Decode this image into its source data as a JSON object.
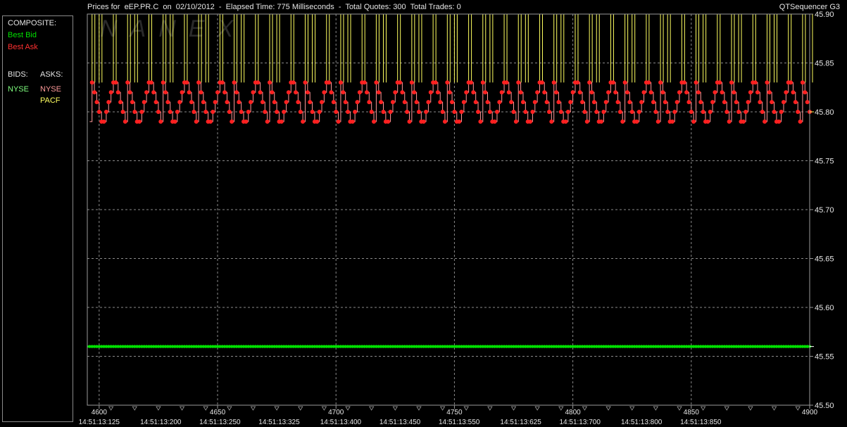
{
  "header": {
    "title": "Prices for  eEP.PR.C  on  02/10/2012  -  Elapsed Time: 775 Milliseconds  -  Total Quotes: 300  Total Trades: 0",
    "app_name": "QTSequencer G3"
  },
  "watermark": "NANEX",
  "legend": {
    "composite_label": "COMPOSITE:",
    "best_bid": "Best Bid",
    "best_ask": "Best Ask",
    "bids_label": "BIDS:",
    "asks_label": "ASKS:",
    "bid_exchanges": [
      "NYSE"
    ],
    "ask_exchanges": [
      "NYSE",
      "PACF"
    ],
    "colors": {
      "best_bid": "#00e000",
      "best_ask": "#ff2020",
      "nyse_bid": "#7fff7f",
      "nyse_ask": "#ff9a9a",
      "pacf_ask": "#ffff60"
    }
  },
  "chart_data": {
    "type": "line",
    "title": "Prices for  eEP.PR.C  on  02/10/2012",
    "xlabel": "",
    "ylabel": "",
    "ylim": [
      45.5,
      45.9
    ],
    "xlim": [
      4595,
      4900
    ],
    "grid": true,
    "yticks": [
      "45.50",
      "45.55",
      "45.60",
      "45.65",
      "45.70",
      "45.75",
      "45.80",
      "45.85",
      "45.90"
    ],
    "xticks": [
      {
        "x": 4600,
        "label": "4600"
      },
      {
        "x": 4650,
        "label": "4650"
      },
      {
        "x": 4700,
        "label": "4700"
      },
      {
        "x": 4750,
        "label": "4750"
      },
      {
        "x": 4800,
        "label": "4800"
      },
      {
        "x": 4850,
        "label": "4850"
      },
      {
        "x": 4900,
        "label": "4900"
      }
    ],
    "time_labels": [
      {
        "x": 4600,
        "label": "14:51:13:125"
      },
      {
        "x": 4626,
        "label": "14:51:13:200"
      },
      {
        "x": 4651,
        "label": "14:51:13:250"
      },
      {
        "x": 4676,
        "label": "14:51:13:325"
      },
      {
        "x": 4702,
        "label": "14:51:13:400"
      },
      {
        "x": 4727,
        "label": "14:51:13:450"
      },
      {
        "x": 4752,
        "label": "14:51:13:550"
      },
      {
        "x": 4778,
        "label": "14:51:13:625"
      },
      {
        "x": 4803,
        "label": "14:51:13:700"
      },
      {
        "x": 4829,
        "label": "14:51:13:800"
      },
      {
        "x": 4854,
        "label": "14:51:13:850"
      }
    ],
    "series": [
      {
        "name": "Best Bid",
        "color": "#00e000",
        "constant": 45.56
      },
      {
        "name": "Best Ask",
        "color": "#ff2020",
        "pattern": [
          45.83,
          45.82,
          45.81,
          45.8,
          45.79,
          45.79,
          45.8,
          45.81,
          45.82,
          45.83,
          45.83,
          45.82,
          45.81,
          45.8,
          45.79
        ],
        "cycle_start": 4597,
        "cycle_length": 15
      },
      {
        "name": "PACF",
        "color": "#ffff60",
        "spike_to": 45.9
      }
    ],
    "current_bid": "45.56",
    "current_ask": "45.80"
  }
}
